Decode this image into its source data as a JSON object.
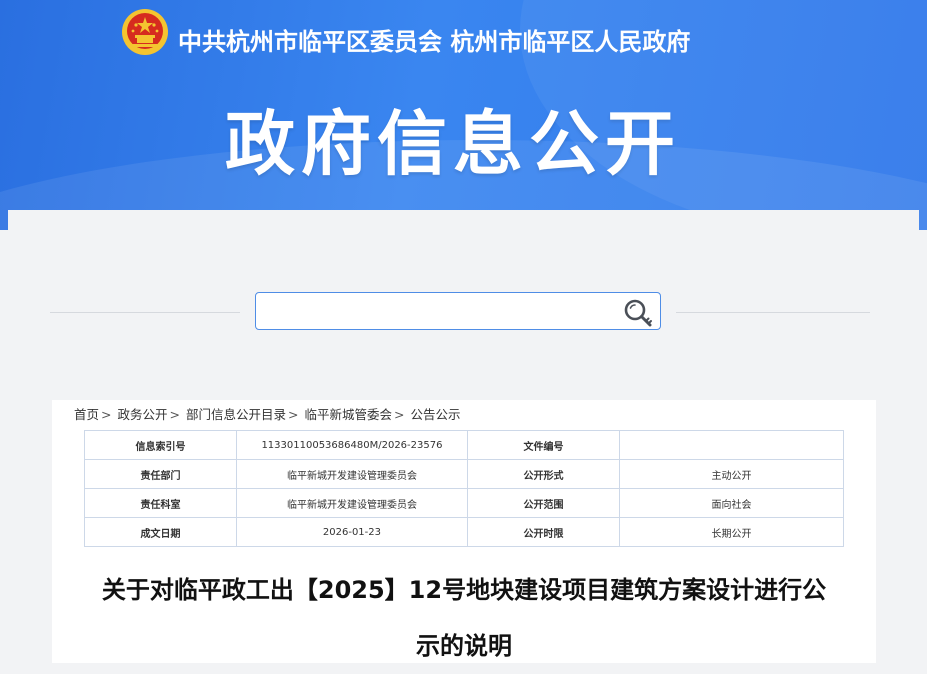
{
  "header": {
    "org_title": "中共杭州市临平区委员会  杭州市临平区人民政府",
    "big_title": "政府信息公开",
    "colors": {
      "banner": "#3a86f0",
      "emblem_red": "#d62b1f",
      "emblem_gold": "#f4c430"
    }
  },
  "search": {
    "value": "",
    "placeholder": "",
    "button_icon": "search-key-icon"
  },
  "breadcrumb": {
    "items": [
      "首页",
      "政务公开",
      "部门信息公开目录",
      "临平新城管委会",
      "公告公示"
    ],
    "separator": ">"
  },
  "meta_table": {
    "rows": [
      {
        "label1": "信息索引号",
        "value1": "11330110053686480M/2026-23576",
        "label2": "文件编号",
        "value2": ""
      },
      {
        "label1": "责任部门",
        "value1": "临平新城开发建设管理委员会",
        "label2": "公开形式",
        "value2": "主动公开"
      },
      {
        "label1": "责任科室",
        "value1": "临平新城开发建设管理委员会",
        "label2": "公开范围",
        "value2": "面向社会"
      },
      {
        "label1": "成文日期",
        "value1": "2026-01-23",
        "label2": "公开时限",
        "value2": "长期公开"
      }
    ]
  },
  "document": {
    "title_line1": "关于对临平政工出【2025】12号地块建设项目建筑方案设计进行公",
    "title_line2": "示的说明"
  }
}
